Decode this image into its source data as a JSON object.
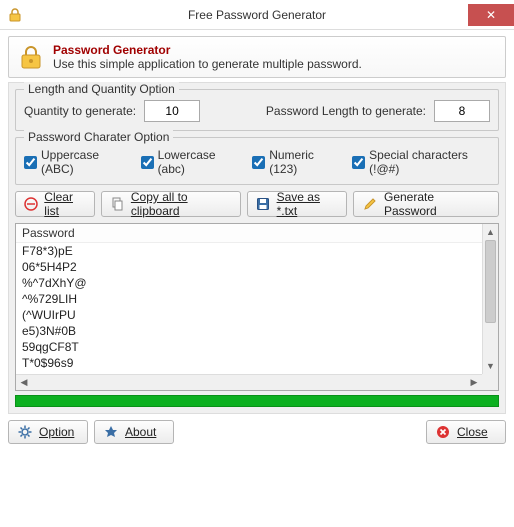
{
  "window": {
    "title": "Free Password Generator",
    "close_glyph": "✕"
  },
  "header": {
    "title": "Password Generator",
    "subtitle": "Use this simple application to generate multiple password."
  },
  "length_group": {
    "legend": "Length and Quantity Option",
    "quantity_label": "Quantity to generate:",
    "quantity_value": "10",
    "length_label": "Password Length to generate:",
    "length_value": "8"
  },
  "char_group": {
    "legend": "Password Charater Option",
    "uppercase_label": "Uppercase (ABC)",
    "lowercase_label": "Lowercase (abc)",
    "numeric_label": "Numeric (123)",
    "special_label": "Special characters (!@#)"
  },
  "actions": {
    "clear_label": "Clear list",
    "copy_label": "Copy all to clipboard",
    "save_label": "Save as *.txt",
    "generate_label": "Generate Password"
  },
  "list": {
    "header": "Password",
    "items": [
      "F78*3)pE",
      "06*5H4P2",
      "%^7dXhY@",
      "^%729LIH",
      "(^WUIrPU",
      "e5)3N#0B",
      "59qgCF8T",
      "T*0$96s9"
    ]
  },
  "bottom": {
    "option_label": "Option",
    "about_label": "About",
    "close_label": "Close"
  },
  "colors": {
    "titlebar_close": "#c75050",
    "header_title": "#a00000",
    "progress_bar": "#0cb020"
  }
}
